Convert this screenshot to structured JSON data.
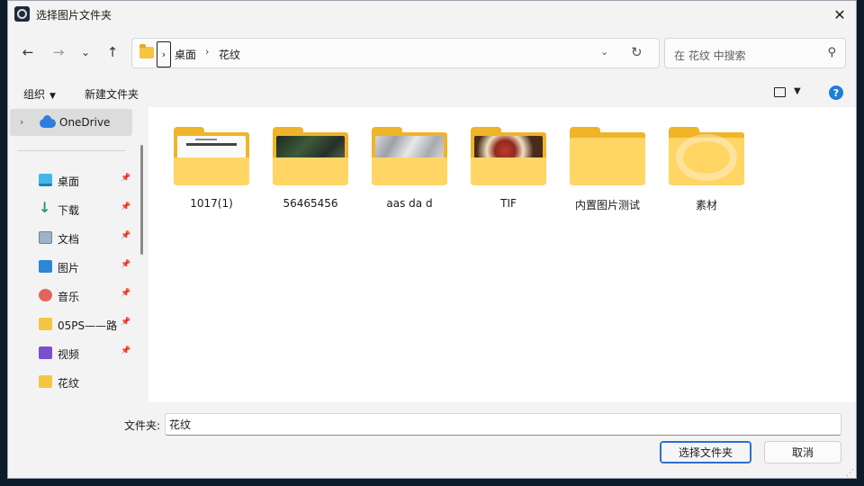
{
  "window": {
    "title": "选择图片文件夹",
    "close": "✕"
  },
  "nav": {
    "back": "←",
    "forward": "→",
    "recent": "⌄",
    "up": "↑",
    "sep_box": "›",
    "crumbs": [
      "桌面",
      "花纹"
    ],
    "crumb_sep": "›",
    "dropdown": "⌄",
    "refresh": "↻"
  },
  "search": {
    "placeholder": "在 花纹 中搜索",
    "icon": "⚲"
  },
  "toolbar": {
    "organize": "组织",
    "organize_caret": "▼",
    "new_folder": "新建文件夹",
    "view_caret": "▼",
    "help": "?"
  },
  "sidebar": {
    "onedrive": {
      "chevron": "›",
      "label": "OneDrive"
    },
    "pin": "📌",
    "items": [
      {
        "label": "桌面",
        "icon": "desktop-icon",
        "pinned": true
      },
      {
        "label": "下载",
        "icon": "download-icon",
        "pinned": true
      },
      {
        "label": "文档",
        "icon": "document-icon",
        "pinned": true
      },
      {
        "label": "图片",
        "icon": "pictures-icon",
        "pinned": true
      },
      {
        "label": "音乐",
        "icon": "music-icon",
        "pinned": true
      },
      {
        "label": "05PS——路",
        "icon": "folder-icon",
        "pinned": true
      },
      {
        "label": "视频",
        "icon": "video-icon",
        "pinned": true
      },
      {
        "label": "花纹",
        "icon": "folder-icon",
        "pinned": false
      }
    ]
  },
  "folders": [
    {
      "name": "1017(1)",
      "thumb": "white-doc"
    },
    {
      "name": "56465456",
      "thumb": "dark-leaves"
    },
    {
      "name": "aas da d",
      "thumb": "marble"
    },
    {
      "name": "TIF",
      "thumb": "food"
    },
    {
      "name": "内置图片测试",
      "thumb": "none"
    },
    {
      "name": "素材",
      "thumb": "swirl"
    }
  ],
  "bottom": {
    "folder_label": "文件夹:",
    "folder_value": "花纹",
    "select_button": "选择文件夹",
    "cancel_button": "取消",
    "grip": "⋰"
  }
}
